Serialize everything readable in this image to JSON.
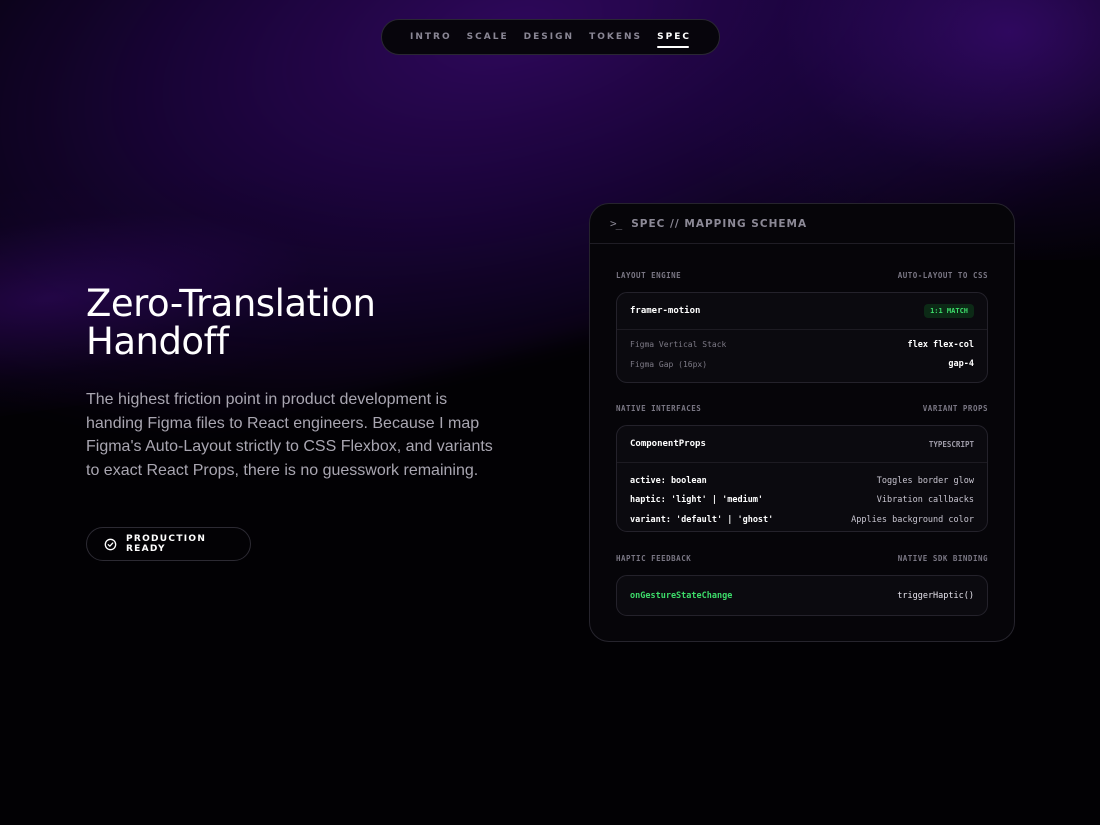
{
  "nav": {
    "tabs": [
      {
        "label": "INTRO"
      },
      {
        "label": "SCALE"
      },
      {
        "label": "DESIGN"
      },
      {
        "label": "TOKENS"
      },
      {
        "label": "SPEC"
      }
    ],
    "active": "SPEC"
  },
  "hero": {
    "title_line1": "Zero-Translation",
    "title_line2": "Handoff",
    "description": "The highest friction point in product development is handing Figma files to React engineers. Because I map Figma's Auto-Layout strictly to CSS Flexbox, and variants to exact React Props, there is no guesswork remaining.",
    "badge": {
      "icon": "check-circle-icon",
      "label": "PRODUCTION READY"
    }
  },
  "spec_card": {
    "prompt_icon": ">_",
    "title": "SPEC // MAPPING SCHEMA",
    "layout": {
      "heading": "LAYOUT ENGINE",
      "heading_right": "AUTO-LAYOUT TO CSS",
      "name": "framer-motion",
      "tag": "1:1 MATCH",
      "rows": [
        {
          "key": "Figma Vertical Stack",
          "value": "flex flex-col"
        },
        {
          "key": "Figma Gap (16px)",
          "value": "gap-4"
        }
      ]
    },
    "interfaces": {
      "heading": "NATIVE INTERFACES",
      "heading_right": "VARIANT PROPS",
      "name": "ComponentProps",
      "tag": "TYPESCRIPT",
      "props": [
        {
          "prop": "active: boolean",
          "desc": "Toggles border glow",
          "color": "#ff5a63"
        },
        {
          "prop": "haptic: 'light' | 'medium'",
          "desc": "Vibration callbacks",
          "color": "#6aa8ff"
        },
        {
          "prop": "variant: 'default' | 'ghost'",
          "desc": "Applies background color",
          "color": "#c07bff"
        }
      ]
    },
    "haptic": {
      "heading": "HAPTIC FEEDBACK",
      "heading_right": "NATIVE SDK BINDING",
      "event": "onGestureStateChange",
      "call": "triggerHaptic()"
    }
  },
  "colors": {
    "accent_green": "#3ddc6a",
    "accent_purple": "#3a0a78",
    "background": "#020104"
  }
}
